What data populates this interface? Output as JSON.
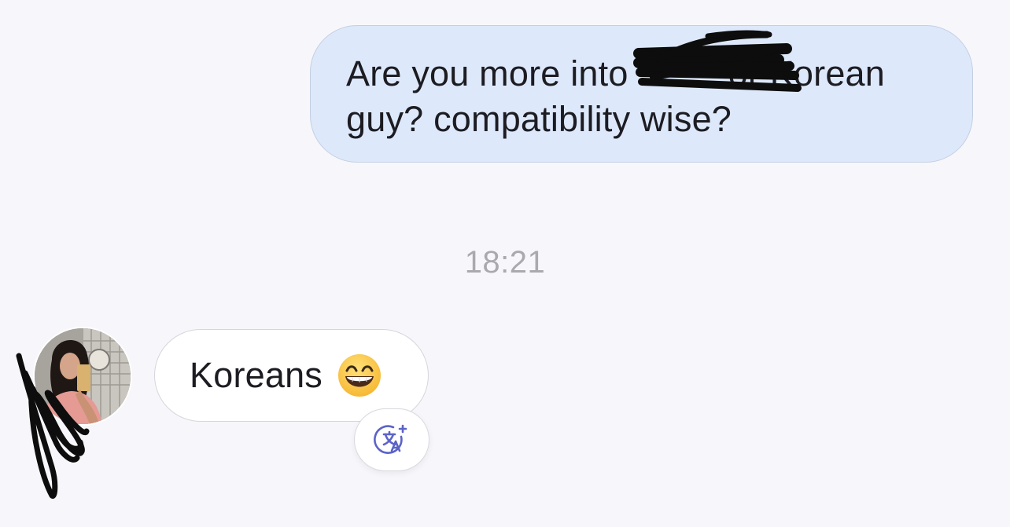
{
  "conversation": {
    "outgoing_message": {
      "line1": "Are you more into          or Korean",
      "line2": "guy? compatibility wise?"
    },
    "timestamp": "18:21",
    "incoming_message": {
      "text": "Koreans",
      "emoji": "grinning-face-with-smiling-eyes"
    },
    "translate_button": {
      "icon": "translate-icon"
    }
  },
  "colors": {
    "background": "#f7f7fb",
    "outgoing_bubble": "#dde9fb",
    "outgoing_border": "#c3cfe2",
    "incoming_bubble": "#ffffff",
    "timestamp_text": "#a9a9ae",
    "translate_icon": "#5b64c7"
  }
}
